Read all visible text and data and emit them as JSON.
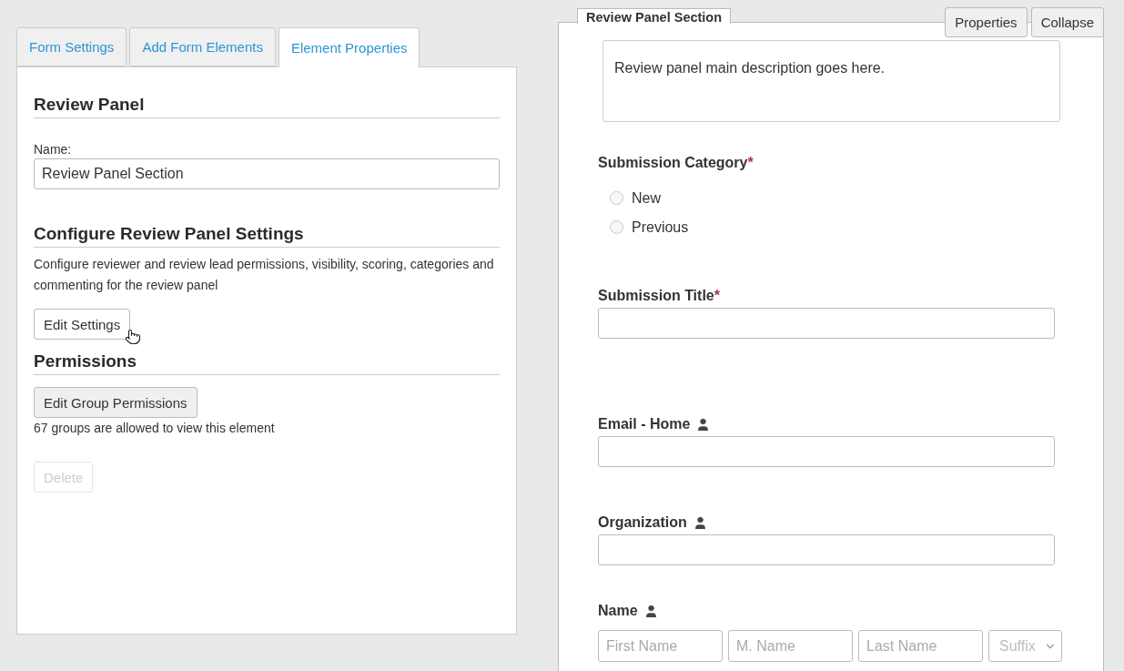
{
  "tabs": [
    {
      "label": "Form Settings",
      "selected": false
    },
    {
      "label": "Add Form Elements",
      "selected": false
    },
    {
      "label": "Element Properties",
      "selected": true
    }
  ],
  "properties_panel": {
    "title": "Review Panel",
    "name_label": "Name:",
    "name_value": "Review Panel Section",
    "settings_heading": "Configure Review Panel Settings",
    "settings_description": "Configure reviewer and review lead permissions, visibility, scoring, categories and commenting for the review panel",
    "edit_settings_button": {
      "label": "Edit Settings",
      "disabled": false
    },
    "permissions_heading": "Permissions",
    "edit_permissions_button": {
      "label": "Edit Group Permissions",
      "disabled": false
    },
    "permissions_note": "67 groups are allowed to view this element",
    "delete_button": {
      "label": "Delete",
      "disabled": true
    }
  },
  "section": {
    "title": "Review Panel Section",
    "buttons": [
      "Properties",
      "Collapse"
    ],
    "description": "Review panel main description goes here.",
    "fields": [
      {
        "kind": "radio",
        "label": "Submission Category",
        "required_mark": "*",
        "contact": false,
        "options": [
          {
            "label": "New",
            "selected": false
          },
          {
            "label": "Previous",
            "selected": false
          }
        ]
      },
      {
        "kind": "text",
        "label": "Submission Title",
        "required_mark": "*",
        "contact": false
      },
      {
        "kind": "text",
        "label": "Email - Home",
        "contact": true
      },
      {
        "kind": "text",
        "label": "Organization",
        "contact": true
      },
      {
        "kind": "name",
        "label": "Name",
        "contact": true,
        "parts": [
          {
            "placeholder": "First Name"
          },
          {
            "placeholder": "M. Name"
          },
          {
            "placeholder": "Last Name"
          }
        ],
        "suffix": {
          "placeholder": "Suffix"
        }
      }
    ]
  }
}
